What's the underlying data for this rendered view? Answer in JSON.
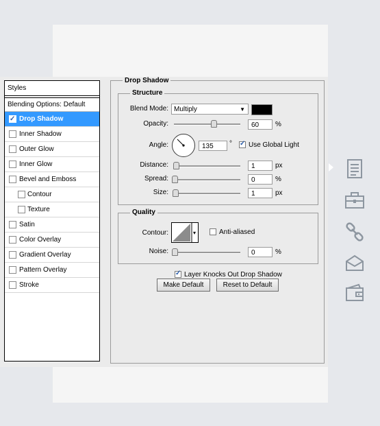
{
  "styles_panel": {
    "header": "Styles",
    "blending_options": "Blending Options: Default",
    "items": [
      {
        "label": "Drop Shadow",
        "checked": true,
        "active": true,
        "sub": false
      },
      {
        "label": "Inner Shadow",
        "checked": false,
        "active": false,
        "sub": false
      },
      {
        "label": "Outer Glow",
        "checked": false,
        "active": false,
        "sub": false
      },
      {
        "label": "Inner Glow",
        "checked": false,
        "active": false,
        "sub": false
      },
      {
        "label": "Bevel and Emboss",
        "checked": false,
        "active": false,
        "sub": false
      },
      {
        "label": "Contour",
        "checked": false,
        "active": false,
        "sub": true
      },
      {
        "label": "Texture",
        "checked": false,
        "active": false,
        "sub": true
      },
      {
        "label": "Satin",
        "checked": false,
        "active": false,
        "sub": false
      },
      {
        "label": "Color Overlay",
        "checked": false,
        "active": false,
        "sub": false
      },
      {
        "label": "Gradient Overlay",
        "checked": false,
        "active": false,
        "sub": false
      },
      {
        "label": "Pattern Overlay",
        "checked": false,
        "active": false,
        "sub": false
      },
      {
        "label": "Stroke",
        "checked": false,
        "active": false,
        "sub": false
      }
    ]
  },
  "drop_shadow": {
    "title": "Drop Shadow",
    "structure": {
      "title": "Structure",
      "blend_mode_label": "Blend Mode:",
      "blend_mode_value": "Multiply",
      "shadow_color": "#000000",
      "opacity_label": "Opacity:",
      "opacity_value": "60",
      "opacity_unit": "%",
      "opacity_fraction": 0.6,
      "angle_label": "Angle:",
      "angle_value": "135",
      "angle_unit": "°",
      "use_global_light_label": "Use Global Light",
      "use_global_light": true,
      "distance_label": "Distance:",
      "distance_value": "1",
      "distance_unit": "px",
      "spread_label": "Spread:",
      "spread_value": "0",
      "spread_unit": "%",
      "size_label": "Size:",
      "size_value": "1",
      "size_unit": "px"
    },
    "quality": {
      "title": "Quality",
      "contour_label": "Contour:",
      "anti_aliased_label": "Anti-aliased",
      "anti_aliased": false,
      "noise_label": "Noise:",
      "noise_value": "0",
      "noise_unit": "%"
    },
    "knockout_label": "Layer Knocks Out Drop Shadow",
    "knockout": true,
    "make_default_label": "Make Default",
    "reset_default_label": "Reset to Default"
  },
  "sidebar_icons": [
    "document-icon",
    "toolbox-icon",
    "link-icon",
    "envelope-icon",
    "wallet-icon"
  ],
  "colors": {
    "accent": "#3399ff",
    "dialog_bg": "#ebebeb",
    "page_bg": "#e6e8ec"
  }
}
